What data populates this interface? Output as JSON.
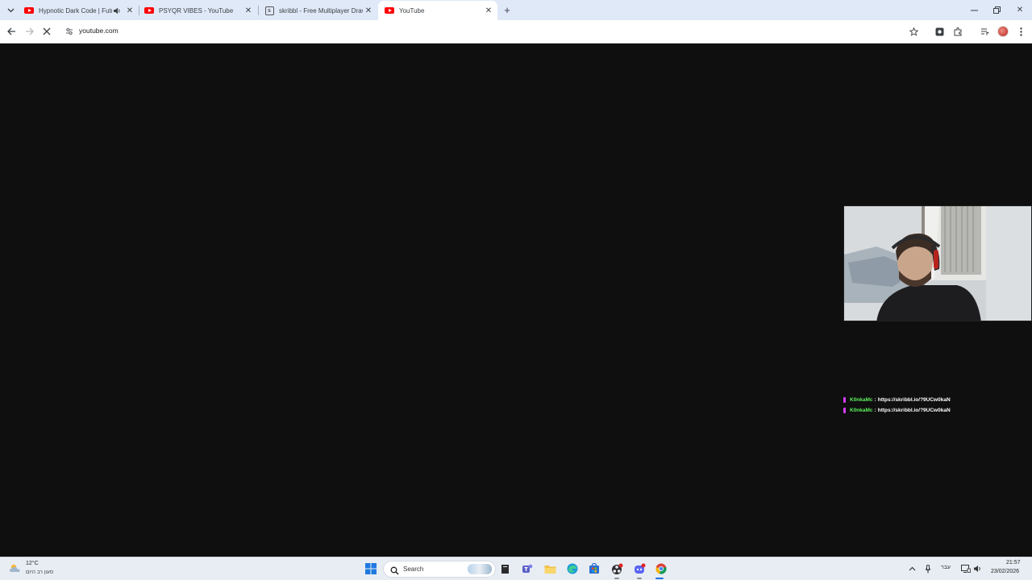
{
  "browser": {
    "tabs": [
      {
        "title": "Hypnotic Dark Code | Futur",
        "favicon": "youtube-icon",
        "audio": true
      },
      {
        "title": "PSYQR VIBES - YouTube",
        "favicon": "youtube-icon"
      },
      {
        "title": "skribbl - Free Multiplayer Draw",
        "favicon": "skribbl-icon"
      },
      {
        "title": "YouTube",
        "favicon": "youtube-icon",
        "active": true
      }
    ],
    "url": "youtube.com",
    "colors": {
      "tabstrip": "#dfe9f8",
      "accent": "#ff0000"
    }
  },
  "stream": {
    "chat": [
      {
        "user": "K0nkaMc",
        "separator": ":",
        "message": "https://skribbl.io/?9UCw0kaN"
      },
      {
        "user": "K0nkaMc",
        "separator": ":",
        "message": "https://skribbl.io/?9UCw0kaN"
      }
    ],
    "colors": {
      "chat_user": "#5cf25c",
      "chat_badge": "#d63cff"
    }
  },
  "taskbar": {
    "weather": {
      "temp": "12°C",
      "desc": "סעון רב היום"
    },
    "search_label": "Search",
    "language": "עבר",
    "time": "21:57",
    "date": "23/02/2026"
  }
}
